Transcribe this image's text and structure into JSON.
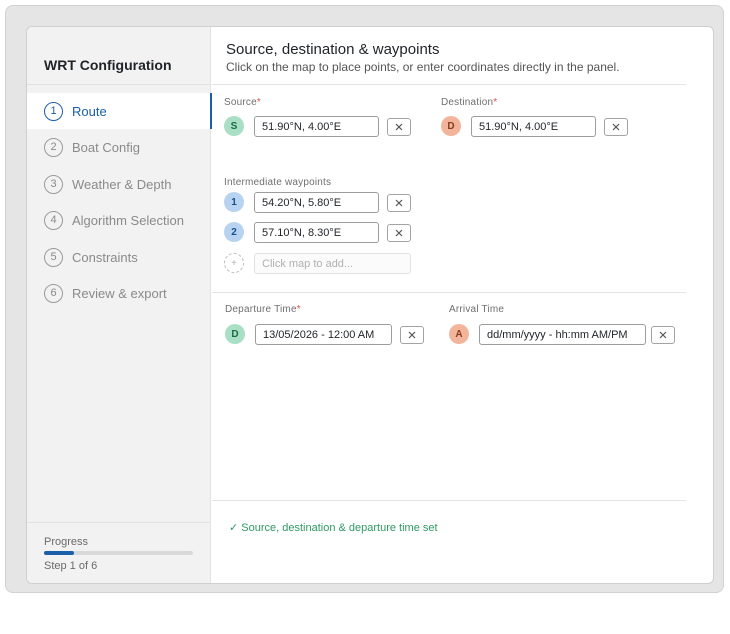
{
  "sidebar": {
    "title": "WRT Configuration",
    "steps": [
      {
        "num": "1",
        "label": "Route"
      },
      {
        "num": "2",
        "label": "Boat Config"
      },
      {
        "num": "3",
        "label": "Weather & Depth"
      },
      {
        "num": "4",
        "label": "Algorithm Selection"
      },
      {
        "num": "5",
        "label": "Constraints"
      },
      {
        "num": "6",
        "label": "Review & export"
      }
    ],
    "active_step": 1,
    "progress_label": "Progress",
    "progress_fraction": 0.2,
    "progress_step_text": "Step 1 of 6"
  },
  "main": {
    "title": "Source, destination & waypoints",
    "subtitle": "Click on the map to place points, or enter coordinates directly in the panel.",
    "source": {
      "label": "Source",
      "required": "*",
      "badge": "S",
      "value": "51.90°N, 4.00°E"
    },
    "destination": {
      "label": "Destination",
      "required": "*",
      "badge": "D",
      "value": "51.90°N, 4.00°E"
    },
    "waypoints_label": "Intermediate waypoints",
    "waypoints": [
      {
        "badge": "1",
        "value": "54.20°N, 5.80°E"
      },
      {
        "badge": "2",
        "value": "57.10°N, 8.30°E"
      }
    ],
    "add_waypoint": {
      "badge": "+",
      "placeholder": "Click map to add..."
    },
    "departure": {
      "label": "Departure Time",
      "required": "*",
      "badge": "D",
      "value": "13/05/2026 - 12:00 AM"
    },
    "arrival": {
      "label": "Arrival Time",
      "badge": "A",
      "placeholder": "dd/mm/yyyy - hh:mm AM/PM"
    },
    "status_text": "✓ Source, destination & departure time set"
  },
  "icons": {
    "clear": "close-icon"
  },
  "colors": {
    "accent": "#1a5fa8",
    "success": "#2f9a63",
    "required": "#d9534f"
  }
}
